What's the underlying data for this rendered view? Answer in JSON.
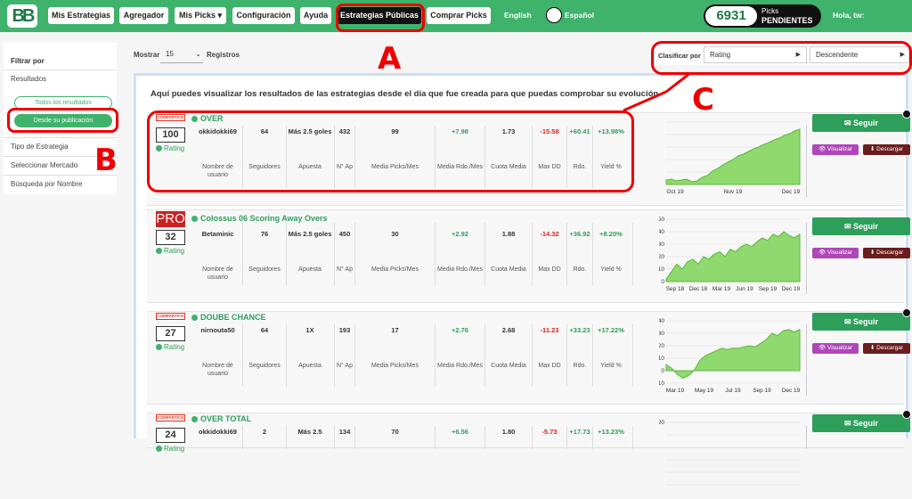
{
  "topbar": {
    "logo": "BB",
    "nav": [
      "Mis Estrategias",
      "Agregador",
      "Mis Picks ▾",
      "Configuración",
      "Ayuda",
      "Estrategias Públicas",
      "Comprar Picks"
    ],
    "lang_en": "English",
    "lang_es": "Español",
    "picks_count": "6931",
    "picks_label1": "Picks",
    "picks_label2": "PENDIENTES",
    "greeting": "Hola, tw:"
  },
  "sidebar": {
    "heading": "Filtrar por",
    "resultados": "Resultados",
    "todos": "Todos los resultados",
    "desde": "Desde su publicación",
    "tipo": "Tipo de Estrategia",
    "mercado": "Seleccionar Mercado",
    "busqueda": "Búsqueda por Nombre"
  },
  "toolbar": {
    "mostrar": "Mostrar",
    "mostrar_value": "15",
    "registros": "Registros",
    "clasificar": "Clasificar por",
    "sort_field": "Rating",
    "sort_order": "Descendente"
  },
  "intro": "Aquí puedes visualizar los resultados de las estrategias desde el día que fue creada para que puedas comprobar su evolución.",
  "headers": [
    "Nombre de usuario",
    "Seguidores",
    "Apuesta",
    "N° Ap",
    "Media Picks/Mes",
    "Media Rdo./Mes",
    "Cuota Media",
    "Max DD",
    "Rdo.",
    "Yield %"
  ],
  "rating_label": "Rating",
  "buttons": {
    "seguir": "✉ Seguir",
    "visualizar": "👁 Visualizar",
    "descargar": "⬇ Descargar"
  },
  "badges": {
    "compartick": "COMPARTICK",
    "pro": "PRO"
  },
  "strategies": [
    {
      "title": "OVER",
      "rating": "100",
      "user": "okkidokki69",
      "followers": "64",
      "bet": "Más 2.5 goles",
      "n_ap": "432",
      "picks_mes": "99",
      "rdo_mes": "+7.98",
      "cuota": "1.73",
      "max_dd": "-15.58",
      "rdo": "+60.41",
      "yield": "+13.98%",
      "badge": "compartick",
      "chart_data": {
        "type": "area",
        "x": [
          "Oct 19",
          "Nov 19",
          "Dec 19"
        ],
        "values": [
          5,
          6,
          4,
          5,
          6,
          3,
          4,
          8,
          10,
          15,
          18,
          22,
          25,
          28,
          32,
          34,
          37,
          40,
          42,
          45,
          47,
          50,
          52,
          55,
          57,
          60,
          62
        ],
        "ylim": [
          0,
          70
        ],
        "grid": true
      }
    },
    {
      "title": "Colossus 06 Scoring Away Overs",
      "rating": "32",
      "user": "Betaminic",
      "followers": "76",
      "bet": "Más 2.5 goles",
      "n_ap": "450",
      "picks_mes": "30",
      "rdo_mes": "+2.92",
      "cuota": "1.88",
      "max_dd": "-14.32",
      "rdo": "+36.92",
      "yield": "+8.20%",
      "badge": "pro",
      "chart_data": {
        "type": "area",
        "x": [
          "Sep 18",
          "Dec 18",
          "Mar 19",
          "Jun 19",
          "Sep 19",
          "Dec 19"
        ],
        "y_ticks": [
          "50",
          "40",
          "30",
          "20",
          "10",
          "0"
        ],
        "values": [
          2,
          8,
          14,
          10,
          16,
          18,
          14,
          20,
          18,
          22,
          24,
          20,
          26,
          24,
          28,
          30,
          28,
          32,
          35,
          33,
          38,
          36,
          40,
          37,
          35,
          38
        ],
        "ylim": [
          0,
          50
        ],
        "grid": true
      }
    },
    {
      "title": "DOUBE CHANCE",
      "rating": "27",
      "user": "nirnouta50",
      "followers": "64",
      "bet": "1X",
      "n_ap": "193",
      "picks_mes": "17",
      "rdo_mes": "+2.76",
      "cuota": "2.68",
      "max_dd": "-11.23",
      "rdo": "+33.23",
      "yield": "+17.22%",
      "badge": "compartick",
      "chart_data": {
        "type": "area",
        "x": [
          "Mar 19",
          "May 19",
          "Jul 19",
          "Sep 19",
          "Dec 19"
        ],
        "y_ticks": [
          "40",
          "30",
          "20",
          "10",
          "0",
          "-10"
        ],
        "values": [
          5,
          2,
          -3,
          -6,
          -4,
          0,
          8,
          12,
          14,
          16,
          18,
          17,
          18,
          18,
          19,
          20,
          19,
          22,
          25,
          30,
          28,
          32,
          33,
          31,
          33
        ],
        "ylim": [
          -10,
          40
        ],
        "grid": true
      }
    },
    {
      "title": "OVER TOTAL",
      "rating": "24",
      "user": "okkidokki69",
      "followers": "2",
      "bet": "Más 2.5",
      "n_ap": "134",
      "picks_mes": "70",
      "rdo_mes": "+6.56",
      "cuota": "1.80",
      "max_dd": "-5.73",
      "rdo": "+17.73",
      "yield": "+13.23%",
      "badge": "compartick",
      "chart_data": {
        "type": "area",
        "x": [],
        "y_ticks": [
          "20"
        ],
        "values": [],
        "ylim": [
          0,
          20
        ],
        "grid": true
      }
    }
  ],
  "annotations": {
    "a": "A",
    "b": "B",
    "c": "C"
  }
}
